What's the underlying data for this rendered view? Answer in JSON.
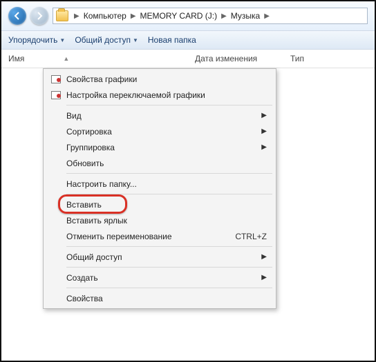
{
  "nav": {
    "crumbs": [
      {
        "label": "Компьютер"
      },
      {
        "label": "MEMORY CARD (J:)"
      },
      {
        "label": "Музыка"
      }
    ]
  },
  "toolbar": {
    "organize": "Упорядочить",
    "share": "Общий доступ",
    "new_folder": "Новая папка"
  },
  "columns": {
    "name": "Имя",
    "date": "Дата изменения",
    "type": "Тип"
  },
  "menu": {
    "graphics_props": "Свойства графики",
    "graphics_switch": "Настройка переключаемой графики",
    "view": "Вид",
    "sort": "Сортировка",
    "group": "Группировка",
    "refresh": "Обновить",
    "customize_folder": "Настроить папку...",
    "paste": "Вставить",
    "paste_shortcut": "Вставить ярлык",
    "undo_rename": "Отменить переименование",
    "undo_shortcut": "CTRL+Z",
    "share_access": "Общий доступ",
    "create": "Создать",
    "properties": "Свойства"
  }
}
